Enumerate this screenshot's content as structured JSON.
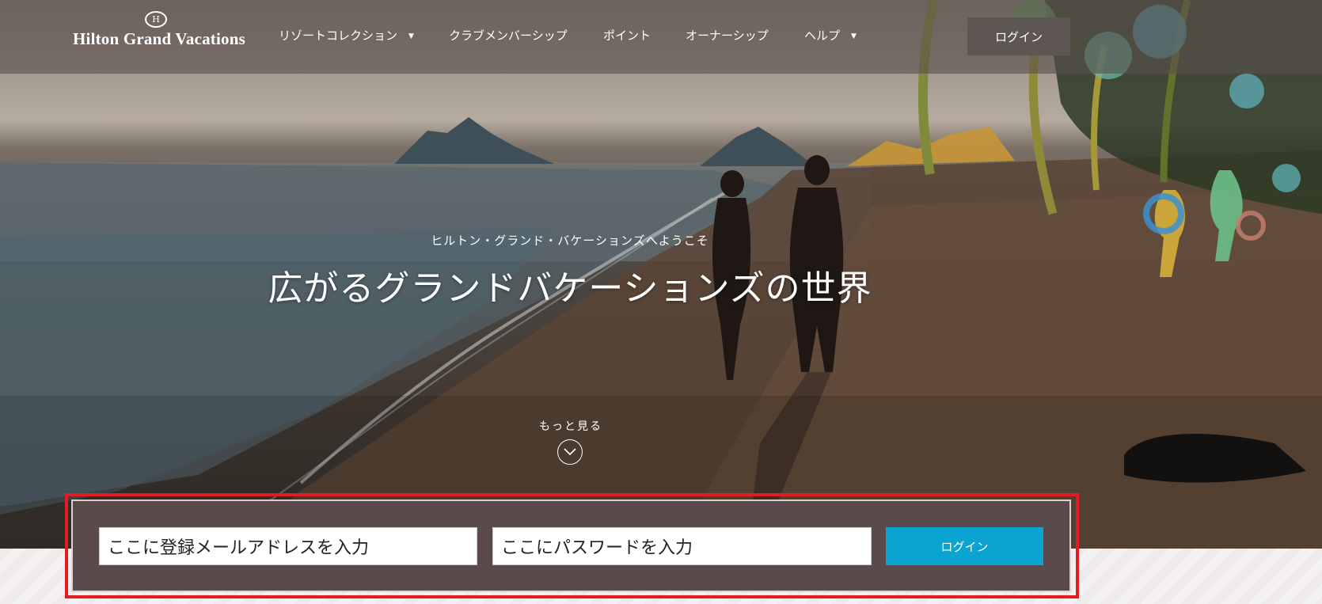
{
  "brand": {
    "name": "Hilton Grand Vacations",
    "mark": "H"
  },
  "nav": {
    "items": [
      {
        "label": "リゾートコレクション",
        "has_dropdown": true
      },
      {
        "label": "クラブメンバーシップ",
        "has_dropdown": false
      },
      {
        "label": "ポイント",
        "has_dropdown": false
      },
      {
        "label": "オーナーシップ",
        "has_dropdown": false
      },
      {
        "label": "ヘルプ",
        "has_dropdown": true
      }
    ],
    "login_label": "ログイン"
  },
  "hero": {
    "welcome": "ヒルトン・グランド・バケーションズへようこそ",
    "headline": "広がるグランドバケーションズの世界",
    "more_label": "もっと見る"
  },
  "login_form": {
    "email_value": "ここに登録メールアドレスを入力",
    "password_value": "ここにパスワードを入力",
    "submit_label": "ログイン"
  },
  "colors": {
    "topbar": "#5a504c",
    "login_button": "#0ba3cf",
    "panel": "#5a4a4b",
    "highlight_frame": "#e31b23"
  }
}
